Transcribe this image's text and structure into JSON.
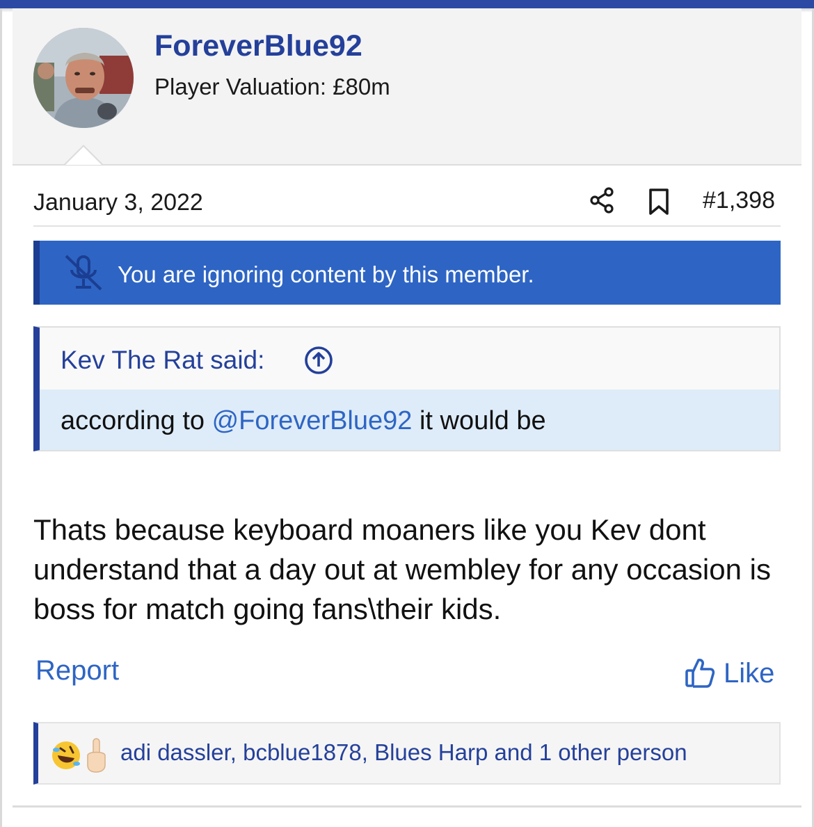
{
  "colors": {
    "brand_blue": "#24409a",
    "link_blue": "#2e65c4",
    "notice_bg": "#2e65c4",
    "quote_body_bg": "#deecf9"
  },
  "author": {
    "username": "ForeverBlue92",
    "valuation": "Player Valuation: £80m"
  },
  "post": {
    "date": "January 3, 2022",
    "number": "#1,398",
    "icons": [
      "share-icon",
      "bookmark-icon"
    ],
    "body": "Thats because keyboard moaners like you Kev dont understand that a day out at wembley for any occasion is boss for match going fans\\their kids."
  },
  "ignore_notice": {
    "icon": "muted-microphone-icon",
    "text": "You are ignoring content by this member."
  },
  "quote": {
    "author": "Kev The Rat said:",
    "text_before": "according to ",
    "mention": "@ForeverBlue92",
    "text_after": " it would be"
  },
  "actions": {
    "report": "Report",
    "like": "Like"
  },
  "reactions": {
    "icons": [
      "rolling-laughing-emoji",
      "middle-finger-emoji"
    ],
    "users": "adi dassler, bcblue1878, Blues Harp and 1 other person"
  }
}
